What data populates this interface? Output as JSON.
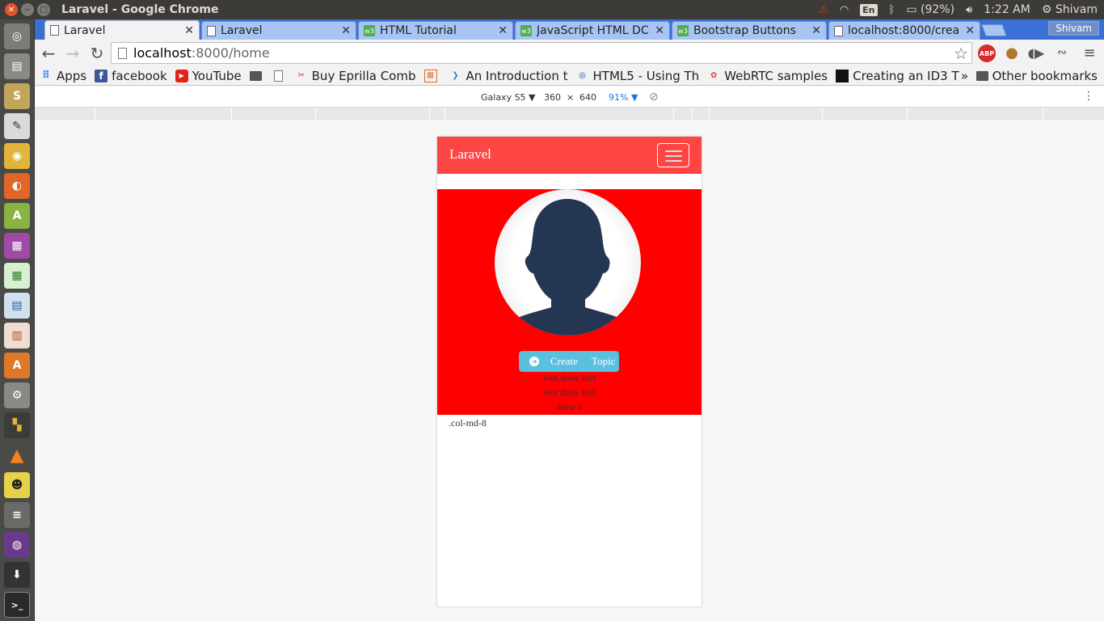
{
  "os": {
    "window_title": "Laravel - Google Chrome",
    "tray": {
      "lang": "En",
      "battery": "(92%)",
      "time": "1:22 AM",
      "user": "Shivam"
    }
  },
  "browser": {
    "tabs": [
      {
        "label": "Laravel",
        "icon": "page-icon"
      },
      {
        "label": "Laravel",
        "icon": "page-icon"
      },
      {
        "label": "HTML Tutorial",
        "icon": "w3schools-icon"
      },
      {
        "label": "JavaScript HTML DC",
        "icon": "w3schools-icon"
      },
      {
        "label": "Bootstrap Buttons",
        "icon": "w3schools-icon"
      },
      {
        "label": "localhost:8000/crea",
        "icon": "page-icon"
      }
    ],
    "profile": "Shivam",
    "url": {
      "host": "localhost",
      "path": ":8000/home"
    },
    "bookmarks": [
      {
        "label": "Apps"
      },
      {
        "label": "facebook"
      },
      {
        "label": "YouTube"
      },
      {
        "label": "Buy Eprilla Comb"
      },
      {
        "label": "An Introduction t"
      },
      {
        "label": "HTML5 - Using Th"
      },
      {
        "label": "WebRTC samples"
      },
      {
        "label": "Creating an ID3 T"
      }
    ],
    "bookmarks_overflow": "»",
    "other_bookmarks": "Other bookmarks"
  },
  "device_toolbar": {
    "device": "Galaxy S5 ▼",
    "width": "360",
    "times": "×",
    "height": "640",
    "zoom": "91% ▼"
  },
  "page": {
    "brand": "Laravel",
    "create_button": "Create Topic",
    "stats": [
      "win draw lost",
      "win draw lost",
      "draw 0"
    ],
    "column_label": ".col-md-8",
    "colors": {
      "navbar": "#fd4544",
      "hero": "#ff0000",
      "button": "#5bc0de"
    }
  }
}
